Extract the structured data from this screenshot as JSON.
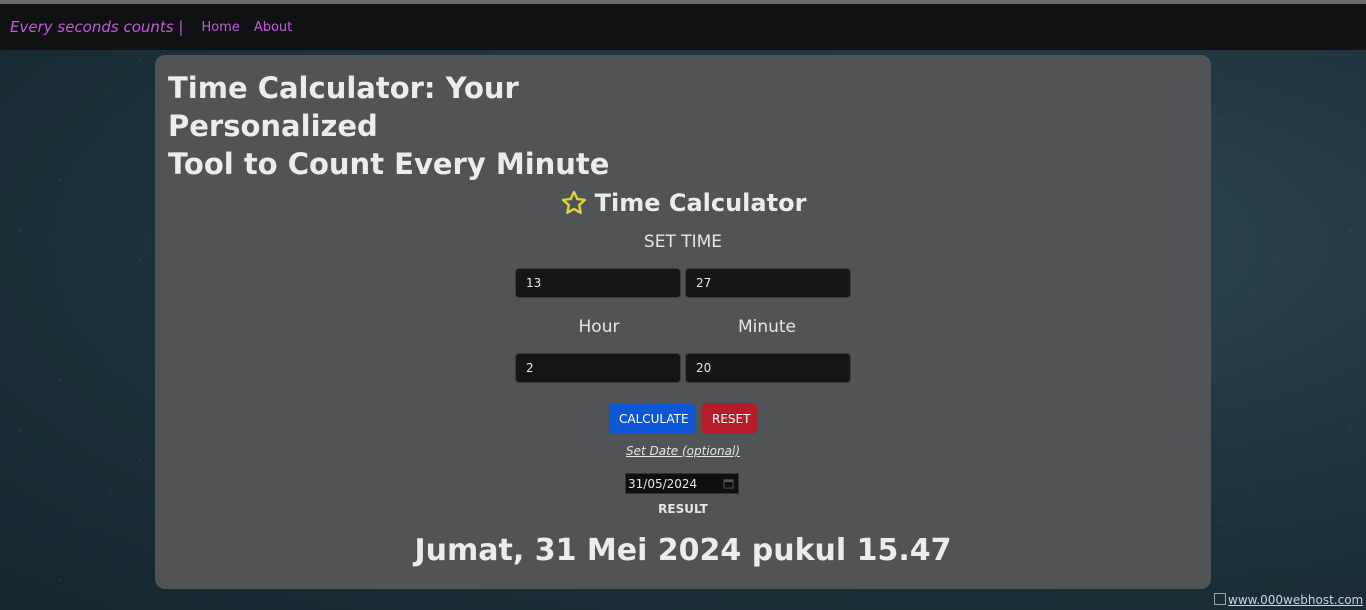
{
  "nav": {
    "brand": "Every seconds counts |",
    "links": [
      "Home",
      "About"
    ]
  },
  "main": {
    "heading_line1": "Time Calculator: Your Personalized",
    "heading_line2": "Tool to Count Every Minute",
    "calc_title": "Time Calculator",
    "set_time_label": "SET TIME",
    "start_hour": "13",
    "start_minute": "27",
    "hour_label": "Hour",
    "minute_label": "Minute",
    "add_hour": "2",
    "add_minute": "20",
    "calculate_label": "CALCULATE",
    "reset_label": "RESET",
    "set_date_label": "Set Date (optional)",
    "date_value": "31/05/2024",
    "result_label": "RESULT",
    "result_value": "Jumat, 31 Mei 2024 pukul 15.47"
  },
  "footer": {
    "badge_text": "www.000webhost.com"
  },
  "colors": {
    "nav_link": "#c25bd8",
    "card_bg": "#505457",
    "calculate_btn": "#0d56d6",
    "reset_btn": "#b51d2a",
    "star": "#e1d43c"
  },
  "icons": [
    "star-icon",
    "calendar-icon"
  ]
}
